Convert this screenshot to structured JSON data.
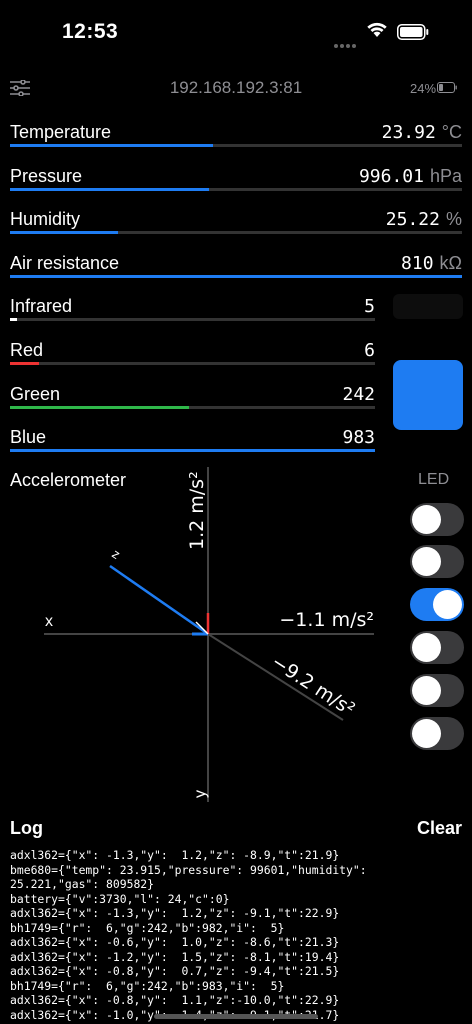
{
  "status_bar": {
    "time": "12:53"
  },
  "header": {
    "host": "192.168.192.3:81",
    "battery_pct": "24%"
  },
  "rows": [
    {
      "label": "Temperature",
      "value": "23.92",
      "unit": "°C",
      "level": 0.45,
      "color": "#1e7cf2"
    },
    {
      "label": "Pressure",
      "value": "996.01",
      "unit": "hPa",
      "level": 0.44,
      "color": "#1e7cf2"
    },
    {
      "label": "Humidity",
      "value": "25.22",
      "unit": "%",
      "level": 0.24,
      "color": "#1e7cf2"
    },
    {
      "label": "Air resistance",
      "value": "810",
      "unit": "kΩ",
      "level": 1.0,
      "color": "#1e7cf2"
    },
    {
      "label": "Infrared",
      "value": "5",
      "unit": "",
      "level": 0.02,
      "color": "#ffffff"
    },
    {
      "label": "Red",
      "value": "6",
      "unit": "",
      "level": 0.08,
      "color": "#e33"
    },
    {
      "label": "Green",
      "value": "242",
      "unit": "",
      "level": 0.49,
      "color": "#2fb84a"
    },
    {
      "label": "Blue",
      "value": "983",
      "unit": "",
      "level": 1.0,
      "color": "#1e7cf2"
    }
  ],
  "accelerometer": {
    "title": "Accelerometer",
    "y_label": "1.2 m/s²",
    "x_label": "−1.1 m/s²",
    "z_label": "−9.2 m/s²",
    "x_axis": "x",
    "y_axis": "y",
    "z_axis": "z"
  },
  "led": {
    "title": "LED",
    "toggles": [
      false,
      false,
      true,
      false,
      false,
      false
    ]
  },
  "log": {
    "title": "Log",
    "clear_label": "Clear",
    "lines": [
      "adxl362={\"x\": -1.3,\"y\":  1.2,\"z\": -8.9,\"t\":21.9}",
      "bme680={\"temp\": 23.915,\"pressure\": 99601,\"humidity\":",
      "25.221,\"gas\": 809582}",
      "battery={\"v\":3730,\"l\": 24,\"c\":0}",
      "adxl362={\"x\": -1.3,\"y\":  1.2,\"z\": -9.1,\"t\":22.9}",
      "bh1749={\"r\":  6,\"g\":242,\"b\":982,\"i\":  5}",
      "adxl362={\"x\": -0.6,\"y\":  1.0,\"z\": -8.6,\"t\":21.3}",
      "adxl362={\"x\": -1.2,\"y\":  1.5,\"z\": -8.1,\"t\":19.4}",
      "adxl362={\"x\": -0.8,\"y\":  0.7,\"z\": -9.4,\"t\":21.5}",
      "bh1749={\"r\":  6,\"g\":242,\"b\":983,\"i\":  5}",
      "adxl362={\"x\": -0.8,\"y\":  1.1,\"z\":-10.0,\"t\":22.9}",
      "adxl362={\"x\": -1.0,\"y\":  1.4,\"z\": -9.1,\"t\":21.7}"
    ]
  }
}
